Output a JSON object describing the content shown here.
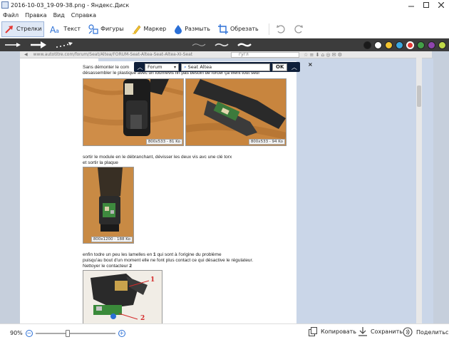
{
  "window": {
    "title": "2016-10-03_19-09-38.png - Яндекс.Диск",
    "controls": [
      "minimize",
      "maximize",
      "close"
    ]
  },
  "menu": {
    "items": [
      "Файл",
      "Правка",
      "Вид",
      "Справка"
    ]
  },
  "toolbar": {
    "tools": [
      {
        "label": "Стрелки",
        "icon": "arrow-icon",
        "active": true
      },
      {
        "label": "Текст",
        "icon": "text-icon",
        "active": false
      },
      {
        "label": "Фигуры",
        "icon": "shapes-icon",
        "active": false
      },
      {
        "label": "Маркер",
        "icon": "marker-icon",
        "active": false
      },
      {
        "label": "Размыть",
        "icon": "blur-icon",
        "active": false
      },
      {
        "label": "Обрезать",
        "icon": "crop-icon",
        "active": false
      }
    ],
    "undo_icon": "undo-icon",
    "redo_icon": "redo-icon"
  },
  "options": {
    "arrow_styles": [
      "thin-arrow",
      "thick-arrow",
      "dotted-arrow"
    ],
    "line_styles": [
      "wave-thin",
      "wave-medium",
      "wave-thick"
    ],
    "colors": [
      "#1a1a1a",
      "#ffffff",
      "#f4c430",
      "#3ba8e0",
      "#e53935",
      "#43a047",
      "#8e44ad",
      "#c0d948"
    ],
    "selected_color": "#e53935"
  },
  "screenshot": {
    "address": "www.autotitre.com/forum/Seat/Altea/FORUM-Seat-Altea-Seat-Altea-XI-Seat",
    "search_field": "гугл",
    "search_bar": {
      "scope": "Forum",
      "query": "Seat Altea",
      "ok_label": "OK"
    },
    "text1": "Sans démonter le com",
    "text2": "désassembler le plastique avec un tournevis fin pas besoin de forcer ça vient tout seul",
    "photo1_caption": "800x533 - 81 Ko",
    "photo2_caption": "800x533 - 94 Ko",
    "text3": "sortir le module en le débranchant, dévisser les deux vis avc une clé torx",
    "text4": "et sortir la plaque",
    "photo3_caption": "800x1200 - 188 Ko",
    "text5_a": "enfin todre un peu les lamelles en ",
    "text5_b": "1",
    "text5_c": " qui sont à l'origine du problème",
    "text6": "puisqu'au bout d'un moment elle ne font plus contact ce qui désactive le régulateur.",
    "text7_a": "Nettoyer le contacteur ",
    "text7_b": "2",
    "marker_1": "1",
    "marker_2": "2"
  },
  "status": {
    "zoom": "90%",
    "zoom_fraction": 0.4,
    "copy_label": "Копировать",
    "save_label": "Сохранить",
    "share_label": "Поделиться"
  }
}
